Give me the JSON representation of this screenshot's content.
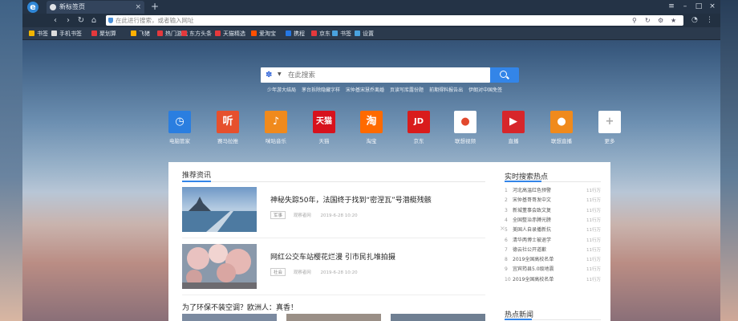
{
  "tab": {
    "title": "新标签页",
    "close": "×",
    "new_tab": "+"
  },
  "window_controls": {
    "menu": "≡",
    "minimize": "–",
    "maximize": "□",
    "close": "×"
  },
  "nav": {
    "back": "‹",
    "forward": "›",
    "reload": "↻",
    "home": "⌂"
  },
  "address": {
    "placeholder": "在此进行搜索，或者输入网址"
  },
  "bookmarks": [
    {
      "label": "书签",
      "color": "#f0b400"
    },
    {
      "label": "手机书签",
      "color": "#dddddd"
    },
    {
      "label": "聚划算",
      "color": "#e4393c"
    },
    {
      "label": "飞猪",
      "color": "#ffb000"
    },
    {
      "label": "热门游戏",
      "color": "#e4393c"
    },
    {
      "label": "东方头条",
      "color": "#e4393c"
    },
    {
      "label": "天猫精选",
      "color": "#e4393c"
    },
    {
      "label": "爱淘宝",
      "color": "#ff5000"
    },
    {
      "label": "携程",
      "color": "#2577e3"
    },
    {
      "label": "京东",
      "color": "#e4393c"
    },
    {
      "label": "书签",
      "color": "#4aa3df"
    },
    {
      "label": "设置",
      "color": "#4aa3df"
    }
  ],
  "search": {
    "placeholder": "在此搜索",
    "hot_words": [
      "少年游大结局",
      "茅台拆除隐藏字样",
      "宋仲基宋慧乔离婚",
      "页读写库露份题",
      "前期得料报告出",
      "伊朗对中国免签"
    ]
  },
  "sites": [
    {
      "label": "电脑管家",
      "glyph": "◷",
      "color": "#2a7ee0"
    },
    {
      "label": "赛马拉推",
      "glyph": "听",
      "color": "#e6502d"
    },
    {
      "label": "咪咕音乐",
      "glyph": "♪",
      "color": "#f08a1c"
    },
    {
      "label": "天猫",
      "glyph": "天猫",
      "color": "#d7121d"
    },
    {
      "label": "淘宝",
      "glyph": "淘",
      "color": "#ff6a00"
    },
    {
      "label": "京东",
      "glyph": "JD",
      "color": "#d91c1c"
    },
    {
      "label": "联想视频",
      "glyph": "●",
      "color": "#ffffff"
    },
    {
      "label": "直播",
      "glyph": "▶",
      "color": "#d7262b"
    },
    {
      "label": "联想直播",
      "glyph": "●",
      "color": "#f08a1c"
    },
    {
      "label": "更多",
      "glyph": "+",
      "color": "#ffffff"
    }
  ],
  "recommended": {
    "title": "推荐资讯",
    "items": [
      {
        "title": "神秘失踪50年，法国终于找到“密涅瓦”号潜艇残骸",
        "tag": "军事",
        "source": "观察者网",
        "time": "2019-6-28 10:20"
      },
      {
        "title": "网红公交车站樱花烂漫 引市民扎堆拍摄",
        "tag": "社会",
        "source": "观察者网",
        "time": "2019-6-28 10:20"
      }
    ],
    "third_title": "为了环保不装空调？欧洲人：真香！",
    "close": "×"
  },
  "hot_search": {
    "title": "实时搜索热点",
    "items": [
      {
        "rank": "1",
        "text": "河北高温红色预警",
        "count": "11行万"
      },
      {
        "rank": "2",
        "text": "宋仲基哥哥发中文",
        "count": "11行万"
      },
      {
        "rank": "3",
        "text": "新城董事会致文复",
        "count": "11行万"
      },
      {
        "rank": "4",
        "text": "全国整治赤膊光膀",
        "count": "11行万"
      },
      {
        "rank": "5",
        "text": "美国人自录播新抗",
        "count": "11行万"
      },
      {
        "rank": "6",
        "text": "清华两博士被退学",
        "count": "11行万"
      },
      {
        "rank": "7",
        "text": "德云社公开道歉",
        "count": "11行万"
      },
      {
        "rank": "8",
        "text": "2019全国高校名单",
        "count": "11行万"
      },
      {
        "rank": "9",
        "text": "宜宾筠县5.0级地震",
        "count": "11行万"
      },
      {
        "rank": "10",
        "text": "2019全国高校名单",
        "count": "11行万"
      }
    ],
    "news_title": "热点新闻"
  }
}
